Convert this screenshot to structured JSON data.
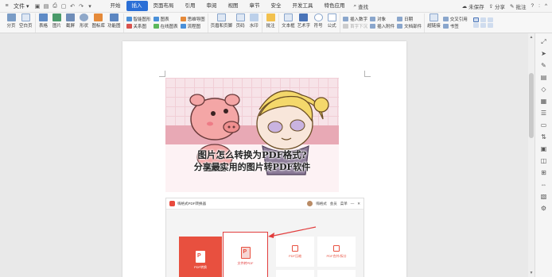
{
  "menubar": {
    "file_label": "文件",
    "tabs": [
      "开始",
      "插入",
      "页面布局",
      "引用",
      "审阅",
      "视图",
      "章节",
      "安全",
      "开发工具",
      "特色应用"
    ],
    "active_tab": "插入",
    "search_label": "查找",
    "unsaved_label": "未保存",
    "share_label": "分享",
    "comment_label": "批注"
  },
  "ribbon": {
    "page_break": "分页",
    "blank_page": "空白页",
    "table": "表格",
    "picture": "图片",
    "screenshot": "截屏",
    "shape": "形状",
    "icon_lib": "图标库",
    "func_chart": "功能图",
    "smart_graphic": "智能图形",
    "chart": "图表",
    "mind_map": "思维导图",
    "relation_chart": "关系图",
    "online_chart": "在线图表",
    "flowchart": "流程图",
    "header_footer": "页眉和页脚",
    "page_number": "页码",
    "watermark": "水印",
    "comment": "批注",
    "textbox": "文本框",
    "art_text": "艺术字",
    "symbol": "符号",
    "formula": "公式",
    "insert_number": "插入数字",
    "object": "对象",
    "date": "日期",
    "first_drop": "首字下沉",
    "attachment": "插入附件",
    "doc_parts": "文档部件",
    "hyperlink": "超链接",
    "cross_ref": "交叉引用",
    "bookmark": "书签"
  },
  "document": {
    "banner_title_line1": "图片怎么转换为PDF格式?",
    "banner_title_line2": "分享最实用的图片转PDF软件",
    "app_name": "嗨格式PDF转换器",
    "user_name": "嗨格式",
    "menu1": "会员",
    "menu2": "菜单",
    "tile_pdf_convert": "PDF转换",
    "tile_file_convert": "文件转PDF",
    "tile_pdf_compress": "PDF压缩",
    "tile_pdf_merge": "PDF合并/拆分"
  },
  "colors": {
    "accent": "#2b6fd6",
    "brand_red": "#e8503f",
    "highlight_red": "#e23d3d"
  }
}
